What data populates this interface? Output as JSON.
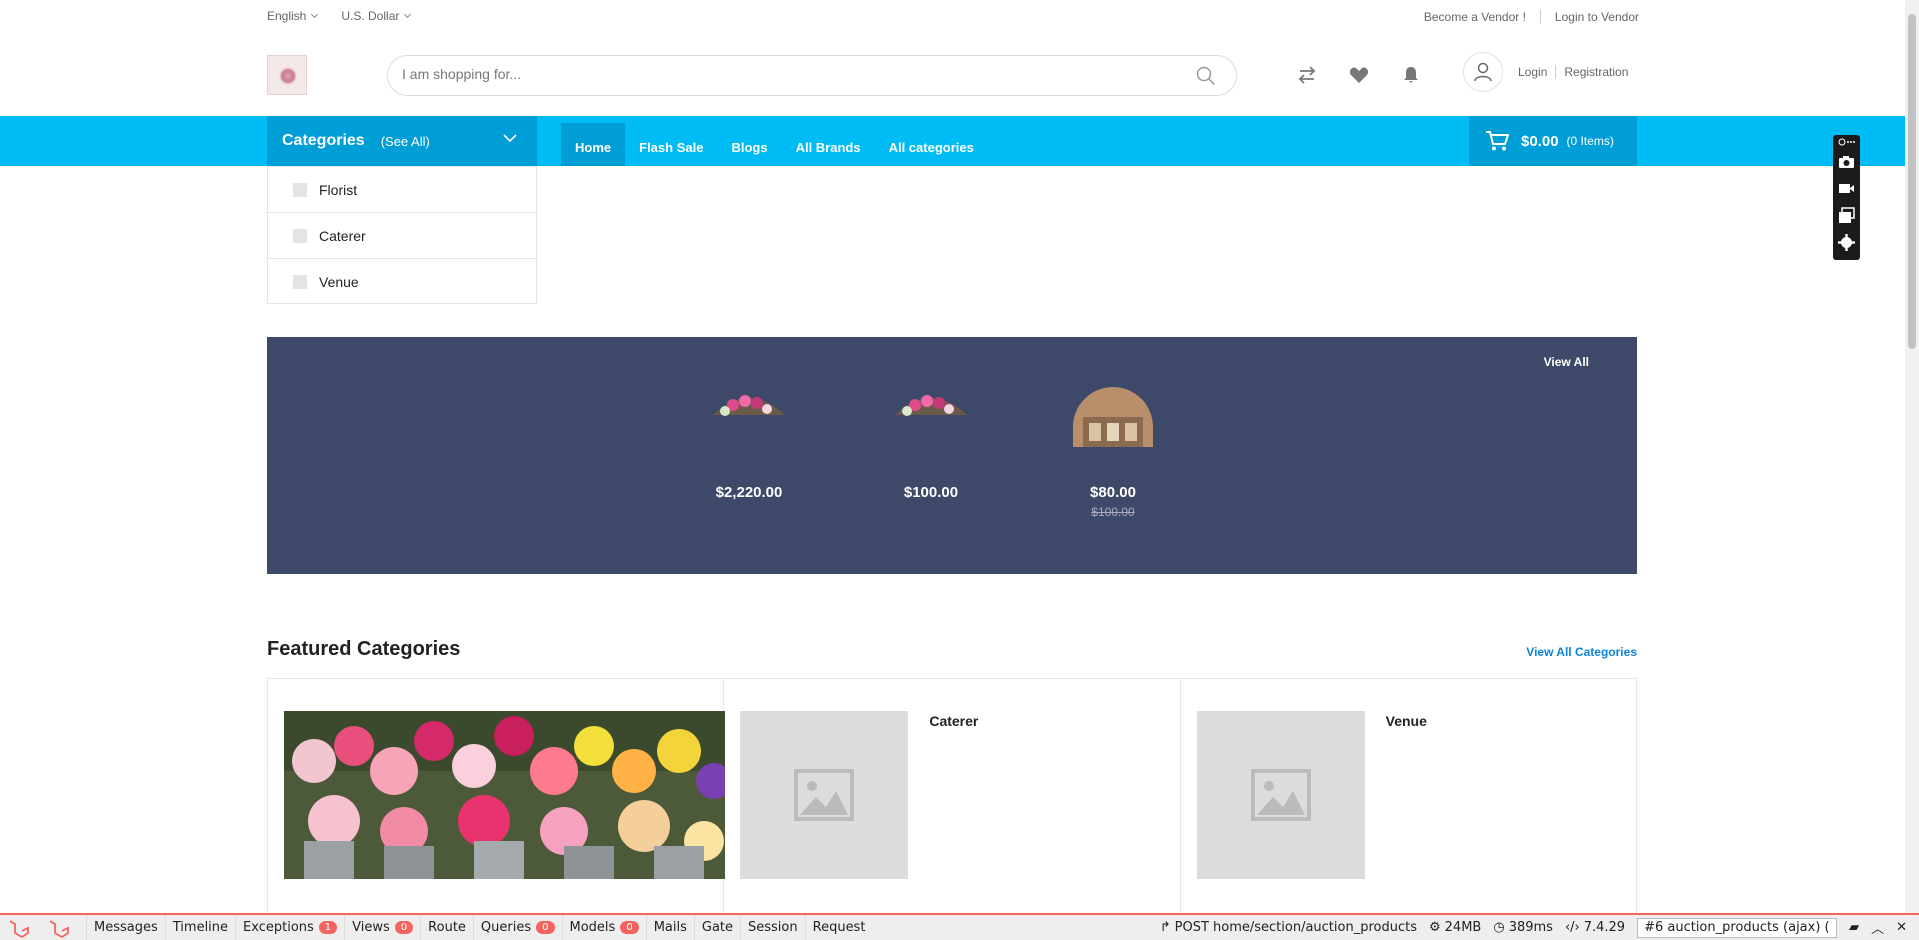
{
  "topbar": {
    "language": "English",
    "currency": "U.S. Dollar",
    "become_vendor": "Become a Vendor !",
    "login_vendor": "Login to Vendor"
  },
  "header": {
    "search_placeholder": "I am shopping for...",
    "login": "Login",
    "registration": "Registration",
    "icons": [
      "compare-icon",
      "heart-icon",
      "bell-icon",
      "user-icon"
    ]
  },
  "nav": {
    "categories_label": "Categories",
    "see_all": "(See All)",
    "links": [
      "Home",
      "Flash Sale",
      "Blogs",
      "All Brands",
      "All categories"
    ],
    "active": "Home",
    "cart_amount": "$0.00",
    "cart_items": "(0 Items)"
  },
  "category_menu": [
    "Florist",
    "Caterer",
    "Venue"
  ],
  "deals": {
    "view_all": "View All",
    "products": [
      {
        "price": "$2,220.00",
        "old_price": ""
      },
      {
        "price": "$100.00",
        "old_price": ""
      },
      {
        "price": "$80.00",
        "old_price": "$100.00"
      }
    ]
  },
  "featured": {
    "title": "Featured Categories",
    "view_all": "View All Categories",
    "items": [
      "",
      "Caterer",
      "Venue"
    ]
  },
  "debugbar": {
    "tabs": [
      {
        "label": "Messages",
        "badge": ""
      },
      {
        "label": "Timeline",
        "badge": ""
      },
      {
        "label": "Exceptions",
        "badge": "1"
      },
      {
        "label": "Views",
        "badge": "0"
      },
      {
        "label": "Route",
        "badge": ""
      },
      {
        "label": "Queries",
        "badge": "0"
      },
      {
        "label": "Models",
        "badge": "0"
      },
      {
        "label": "Mails",
        "badge": ""
      },
      {
        "label": "Gate",
        "badge": ""
      },
      {
        "label": "Session",
        "badge": ""
      },
      {
        "label": "Request",
        "badge": ""
      }
    ],
    "request": "POST home/section/auction_products",
    "memory": "24MB",
    "time": "389ms",
    "version": "7.4.29",
    "selector": "#6 auction_products (ajax) (",
    "accent": "#f4645f"
  },
  "colors": {
    "nav_bg": "#00bcf5",
    "nav_active": "#009ed6",
    "banner_bg": "#3e4869",
    "link": "#0a84d8"
  }
}
